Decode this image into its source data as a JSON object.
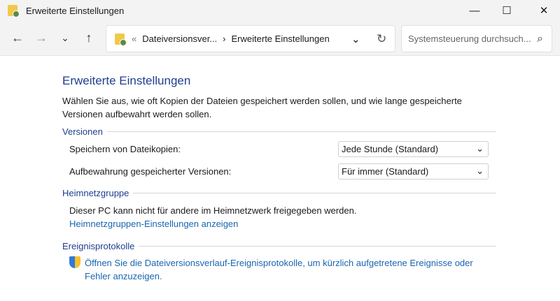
{
  "window": {
    "title": "Erweiterte Einstellungen",
    "minimize": "—",
    "maximize": "☐",
    "close": "✕"
  },
  "nav": {
    "back": "←",
    "forward": "→",
    "recent": "⌄",
    "up": "↑",
    "breadcrumb_sep": "«",
    "crumbs": [
      "Dateiversionsver...",
      "Erweiterte Einstellungen"
    ],
    "crumb_arrow": "›",
    "dropdown": "⌄",
    "refresh": "↻",
    "search_placeholder": "Systemsteuerung durchsuch...",
    "search_icon": "⌕"
  },
  "main": {
    "title": "Erweiterte Einstellungen",
    "description": "Wählen Sie aus, wie oft Kopien der Dateien gespeichert werden sollen, und wie lange gespeicherte Versionen aufbewahrt werden sollen.",
    "versions": {
      "heading": "Versionen",
      "save_label": "Speichern von Dateikopien:",
      "save_value": "Jede Stunde (Standard)",
      "keep_label": "Aufbewahrung gespeicherter Versionen:",
      "keep_value": "Für immer (Standard)"
    },
    "homegroup": {
      "heading": "Heimnetzgruppe",
      "text": "Dieser PC kann nicht für andere im Heimnetzwerk freigegeben werden.",
      "link": "Heimnetzgruppen-Einstellungen anzeigen"
    },
    "events": {
      "heading": "Ereignisprotokolle",
      "link": "Öffnen Sie die Dateiversionsverlauf-Ereignisprotokolle, um kürzlich aufgetretene Ereignisse oder Fehler anzuzeigen."
    }
  }
}
